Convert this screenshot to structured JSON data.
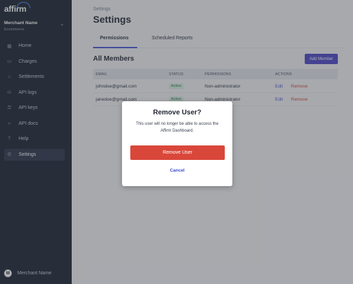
{
  "sidebar": {
    "logo": "affirm",
    "merchant_name": "Merchant Name",
    "merchant_sub": "Ecommerce",
    "items": [
      {
        "label": "Home",
        "icon": "grid-icon"
      },
      {
        "label": "Charges",
        "icon": "card-icon"
      },
      {
        "label": "Settlements",
        "icon": "bank-icon"
      },
      {
        "label": "API logs",
        "icon": "code-icon"
      },
      {
        "label": "API keys",
        "icon": "key-icon"
      },
      {
        "label": "API docs",
        "icon": "code-icon"
      },
      {
        "label": "Help",
        "icon": "help-icon"
      },
      {
        "label": "Settings",
        "icon": "gear-icon",
        "active": true
      }
    ],
    "user_initial": "M",
    "user_name": "Merchant Name"
  },
  "main": {
    "breadcrumb": "Settings",
    "title": "Settings",
    "tabs": [
      {
        "label": "Permissions",
        "active": true
      },
      {
        "label": "Scheduled Reports"
      }
    ],
    "section_title": "All Members",
    "add_member_label": "Add Member",
    "table": {
      "headers": [
        "EMAIL",
        "STATUS",
        "PERMISSIONS",
        "ACTIONS"
      ],
      "rows": [
        {
          "email": "johndoe@gmail.com",
          "status": "Active",
          "permission": "Non-administrator",
          "edit": "Edit",
          "remove": "Remove"
        },
        {
          "email": "janedoe@gmail.com",
          "status": "Active",
          "permission": "Non-administrator",
          "edit": "Edit",
          "remove": "Remove"
        }
      ]
    }
  },
  "modal": {
    "title": "Remove User?",
    "message": "This user will no longer be able to access the Affirm Dashboard.",
    "confirm_label": "Remove User",
    "cancel_label": "Cancel"
  },
  "colors": {
    "sidebar_bg": "#1b2130",
    "accent": "#4a44c6",
    "danger": "#d9473a",
    "active_badge": "#2f7a4e"
  }
}
